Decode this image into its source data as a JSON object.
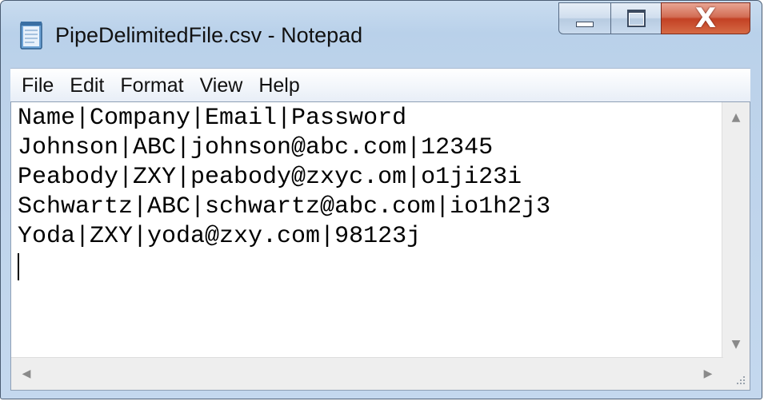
{
  "window": {
    "title": "PipeDelimitedFile.csv - Notepad",
    "controls": {
      "minimize": "minimize",
      "maximize": "maximize",
      "close": "X"
    }
  },
  "menu": {
    "items": [
      "File",
      "Edit",
      "Format",
      "View",
      "Help"
    ]
  },
  "document": {
    "lines": [
      "Name|Company|Email|Password",
      "Johnson|ABC|johnson@abc.com|12345",
      "Peabody|ZXY|peabody@zxyc.om|o1ji23i",
      "Schwartz|ABC|schwartz@abc.com|io1h2j3",
      "Yoda|ZXY|yoda@zxy.com|98123j"
    ]
  },
  "scrollbars": {
    "up_arrow": "▲",
    "down_arrow": "▼",
    "left_arrow": "◀",
    "right_arrow": "▶"
  },
  "colors": {
    "frame": "#b9d1ea",
    "close_button": "#c34124",
    "text": "#000000"
  },
  "icons": {
    "app": "notepad-icon",
    "minimize": "minimize-icon",
    "maximize": "maximize-icon",
    "close": "close-icon",
    "resize": "resize-grip-icon"
  }
}
